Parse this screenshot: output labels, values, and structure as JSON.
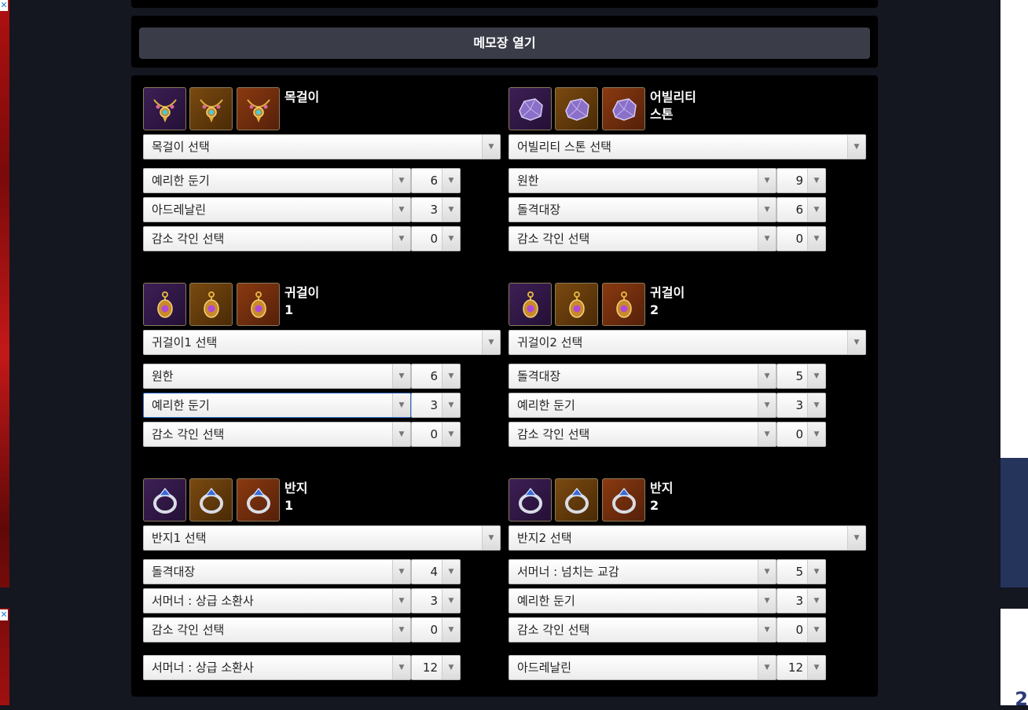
{
  "memo_button": "메모장 열기",
  "blocks": [
    {
      "name": "목걸이",
      "select": "목걸이 선택",
      "icons": [
        "necklace-icon",
        "necklace-icon",
        "necklace-icon"
      ],
      "engravings": [
        {
          "name": "예리한 둔기",
          "level": "6"
        },
        {
          "name": "아드레날린",
          "level": "3"
        },
        {
          "name": "감소 각인 선택",
          "level": "0"
        }
      ]
    },
    {
      "name": "어빌리티\n스톤",
      "select": "어빌리티 스톤 선택",
      "icons": [
        "ability-stone-icon",
        "ability-stone-icon",
        "ability-stone-icon"
      ],
      "engravings": [
        {
          "name": "원한",
          "level": "9"
        },
        {
          "name": "돌격대장",
          "level": "6"
        },
        {
          "name": "감소 각인 선택",
          "level": "0"
        }
      ]
    },
    {
      "name": "귀걸이\n1",
      "select": "귀걸이1 선택",
      "icons": [
        "earring-icon",
        "earring-icon",
        "earring-icon"
      ],
      "engravings": [
        {
          "name": "원한",
          "level": "6"
        },
        {
          "name": "예리한 둔기",
          "level": "3"
        },
        {
          "name": "감소 각인 선택",
          "level": "0"
        }
      ]
    },
    {
      "name": "귀걸이\n2",
      "select": "귀걸이2 선택",
      "icons": [
        "earring-icon",
        "earring-icon",
        "earring-icon"
      ],
      "engravings": [
        {
          "name": "돌격대장",
          "level": "5"
        },
        {
          "name": "예리한 둔기",
          "level": "3"
        },
        {
          "name": "감소 각인 선택",
          "level": "0"
        }
      ]
    },
    {
      "name": "반지\n1",
      "select": "반지1 선택",
      "icons": [
        "ring-icon",
        "ring-icon",
        "ring-icon"
      ],
      "engravings": [
        {
          "name": "돌격대장",
          "level": "4"
        },
        {
          "name": "서머너 : 상급 소환사",
          "level": "3"
        },
        {
          "name": "감소 각인 선택",
          "level": "0"
        }
      ]
    },
    {
      "name": "반지\n2",
      "select": "반지2 선택",
      "icons": [
        "ring-icon",
        "ring-icon",
        "ring-icon"
      ],
      "engravings": [
        {
          "name": "서머너 : 넘치는 교감",
          "level": "5"
        },
        {
          "name": "예리한 둔기",
          "level": "3"
        },
        {
          "name": "감소 각인 선택",
          "level": "0"
        }
      ]
    }
  ],
  "book_engravings": [
    {
      "name": "서머너 : 상급 소환사",
      "level": "12"
    },
    {
      "name": "아드레날린",
      "level": "12"
    }
  ],
  "colors": {
    "panel": "#000000",
    "page": "#141620",
    "button": "#3a3d48"
  }
}
